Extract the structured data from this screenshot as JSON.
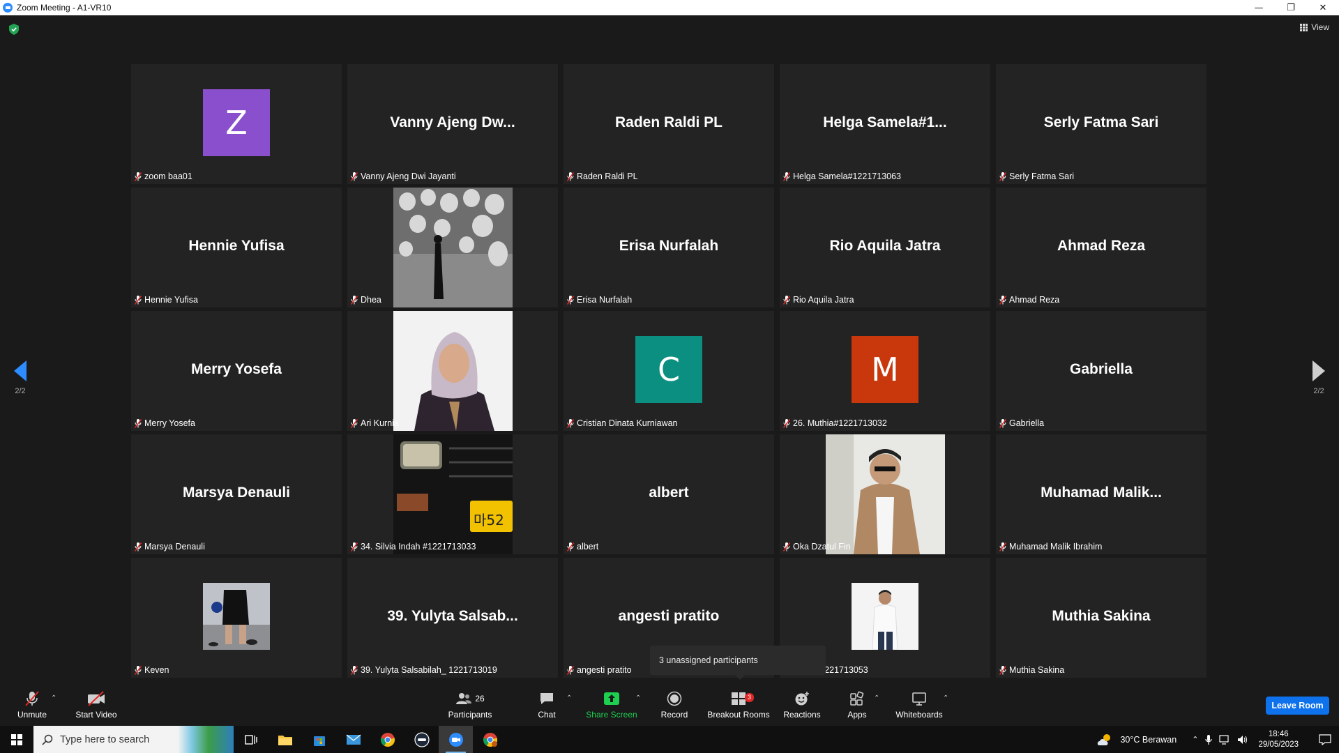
{
  "window": {
    "title": "Zoom Meeting - A1-VR10",
    "minimize": "—",
    "restore": "❐",
    "close": "✕"
  },
  "meeting": {
    "view_label": "View",
    "page_left": "2/2",
    "page_right": "2/2",
    "tiles": [
      {
        "type": "avatar",
        "initial": "Z",
        "color": "#8a4fcc",
        "label": "zoom baa01"
      },
      {
        "type": "name",
        "big": "Vanny  Ajeng  Dw...",
        "label": "Vanny Ajeng Dwi Jayanti"
      },
      {
        "type": "name",
        "big": "Raden Raldi PL",
        "label": "Raden Raldi PL"
      },
      {
        "type": "name",
        "big": "Helga  Samela#1...",
        "label": "Helga Samela#1221713063"
      },
      {
        "type": "name",
        "big": "Serly Fatma Sari",
        "label": "Serly Fatma Sari"
      },
      {
        "type": "name",
        "big": "Hennie Yufisa",
        "label": "Hennie Yufisa"
      },
      {
        "type": "photo",
        "photo": "lanterns",
        "label": "Dhea"
      },
      {
        "type": "name",
        "big": "Erisa Nurfalah",
        "label": "Erisa Nurfalah"
      },
      {
        "type": "name",
        "big": "Rio Aquila Jatra",
        "label": "Rio Aquila Jatra"
      },
      {
        "type": "name",
        "big": "Ahmad Reza",
        "label": "Ahmad Reza"
      },
      {
        "type": "name",
        "big": "Merry Yosefa",
        "label": "Merry Yosefa"
      },
      {
        "type": "photo",
        "photo": "hijab",
        "label": "Ari Kurnia"
      },
      {
        "type": "avatar",
        "initial": "C",
        "color": "#0a8f80",
        "label": "Cristian Dinata Kurniawan"
      },
      {
        "type": "avatar",
        "initial": "M",
        "color": "#c8380c",
        "label": "26. Muthia#1221713032"
      },
      {
        "type": "name",
        "big": "Gabriella",
        "label": "Gabriella"
      },
      {
        "type": "name",
        "big": "Marsya Denauli",
        "label": "Marsya Denauli"
      },
      {
        "type": "photo",
        "photo": "car",
        "label": "34. Silvia Indah #1221713033"
      },
      {
        "type": "name",
        "big": "albert",
        "label": "albert"
      },
      {
        "type": "photo",
        "photo": "jacket",
        "label": "Oka Dzatul Fin"
      },
      {
        "type": "name",
        "big": "Muhamad  Malik...",
        "label": "Muhamad Malik Ibrahim"
      },
      {
        "type": "photo-sm",
        "photo": "gym",
        "label": "Keven"
      },
      {
        "type": "name",
        "big": "39. Yulyta Salsab...",
        "label": "39. Yulyta Salsabilah_ 1221713019"
      },
      {
        "type": "name",
        "big": "angesti pratito",
        "label": "angesti pratito"
      },
      {
        "type": "photo-sm",
        "photo": "man-white",
        "label": "nand #1221713053"
      },
      {
        "type": "name",
        "big": "Muthia Sakina",
        "label": "Muthia Sakina"
      }
    ],
    "tooltip": "3 unassigned participants"
  },
  "toolbar": {
    "unmute": "Unmute",
    "start_video": "Start Video",
    "participants": "Participants",
    "participants_count": "26",
    "chat": "Chat",
    "share_screen": "Share Screen",
    "record": "Record",
    "breakout_rooms": "Breakout Rooms",
    "breakout_badge": "3",
    "reactions": "Reactions",
    "apps": "Apps",
    "whiteboards": "Whiteboards",
    "leave": "Leave Room",
    "share_color": "#1fcf4f",
    "leave_color": "#0e72ed"
  },
  "taskbar": {
    "search_placeholder": "Type here to search",
    "weather": "30°C  Berawan",
    "time": "18:46",
    "date": "29/05/2023"
  }
}
